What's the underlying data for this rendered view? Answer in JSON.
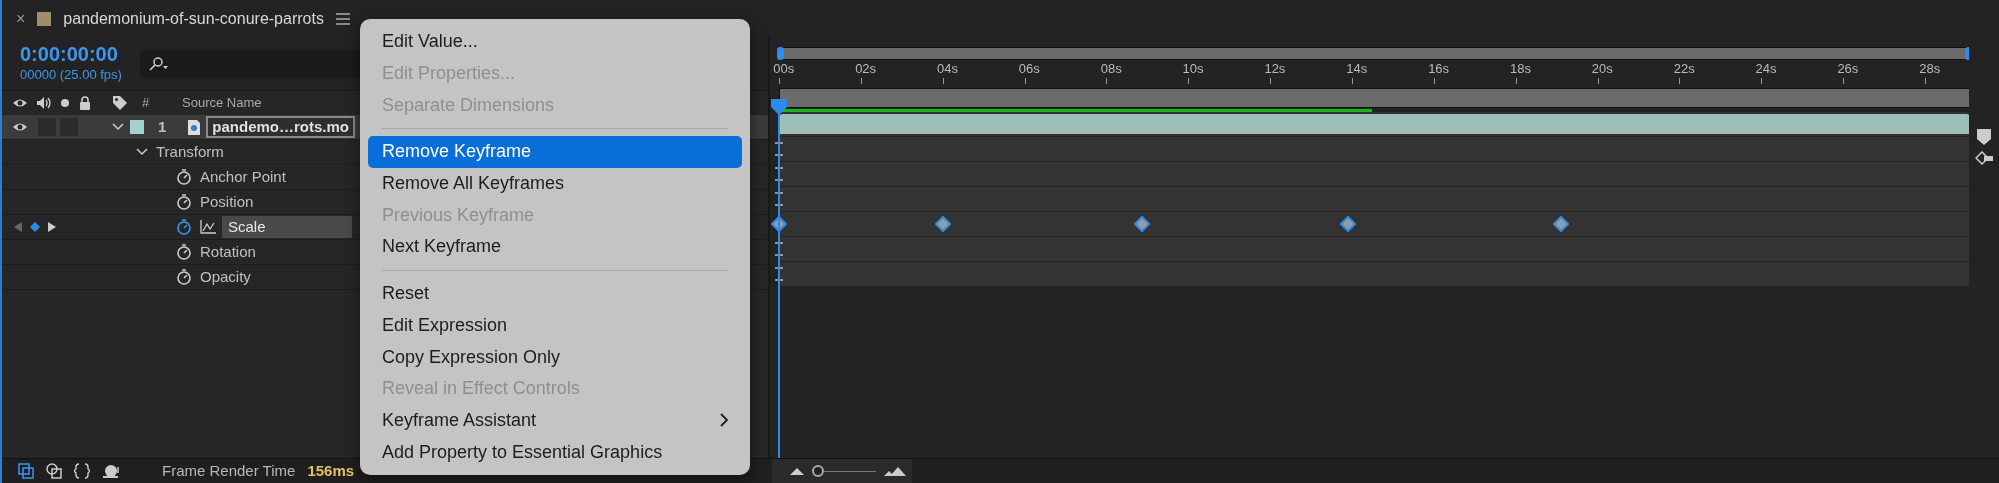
{
  "tab": {
    "close": "×",
    "title": "pandemonium-of-sun-conure-parrots"
  },
  "timecode": "0:00:00:00",
  "frame_info": "00000 (25.00 fps)",
  "columns": [
    "#",
    "Source Name"
  ],
  "layer": {
    "number": "1",
    "name": "pandemo…rots.mo",
    "expanded": true,
    "visible": true
  },
  "group": {
    "name": "Transform",
    "expanded": true
  },
  "properties": [
    {
      "name": "Anchor Point",
      "animated": false,
      "selected": false
    },
    {
      "name": "Position",
      "animated": false,
      "selected": false
    },
    {
      "name": "Scale",
      "animated": true,
      "selected": true
    },
    {
      "name": "Rotation",
      "animated": false,
      "selected": false
    },
    {
      "name": "Opacity",
      "animated": false,
      "selected": false
    }
  ],
  "timeline": {
    "ruler": [
      "00s",
      "02s",
      "04s",
      "06s",
      "08s",
      "10s",
      "12s",
      "14s",
      "16s",
      "18s",
      "20s",
      "22s",
      "24s",
      "26s",
      "28s"
    ],
    "playhead": {
      "level": 0
    },
    "render_bar": {
      "level": 0.498
    },
    "keyframes": [
      {
        "level": 0
      },
      {
        "level": 0.138
      },
      {
        "level": 0.305
      },
      {
        "level": 0.478
      },
      {
        "level": 0.657
      }
    ],
    "zoom_slider": {
      "level": 0
    }
  },
  "status": {
    "label": "Frame Render Time",
    "value": "156ms"
  },
  "menu": [
    {
      "kind": "item",
      "label": "Edit Value...",
      "disabled": false,
      "selected": false,
      "submenu": false
    },
    {
      "kind": "item",
      "label": "Edit Properties...",
      "disabled": true,
      "selected": false,
      "submenu": false
    },
    {
      "kind": "item",
      "label": "Separate Dimensions",
      "disabled": true,
      "selected": false,
      "submenu": false
    },
    {
      "kind": "separator"
    },
    {
      "kind": "item",
      "label": "Remove Keyframe",
      "disabled": false,
      "selected": true,
      "submenu": false
    },
    {
      "kind": "item",
      "label": "Remove All Keyframes",
      "disabled": false,
      "selected": false,
      "submenu": false
    },
    {
      "kind": "item",
      "label": "Previous Keyframe",
      "disabled": true,
      "selected": false,
      "submenu": false
    },
    {
      "kind": "item",
      "label": "Next Keyframe",
      "disabled": false,
      "selected": false,
      "submenu": false
    },
    {
      "kind": "separator"
    },
    {
      "kind": "item",
      "label": "Reset",
      "disabled": false,
      "selected": false,
      "submenu": false
    },
    {
      "kind": "item",
      "label": "Edit Expression",
      "disabled": false,
      "selected": false,
      "submenu": false
    },
    {
      "kind": "item",
      "label": "Copy Expression Only",
      "disabled": false,
      "selected": false,
      "submenu": false
    },
    {
      "kind": "item",
      "label": "Reveal in Effect Controls",
      "disabled": true,
      "selected": false,
      "submenu": false
    },
    {
      "kind": "item",
      "label": "Keyframe Assistant",
      "disabled": false,
      "selected": false,
      "submenu": true
    },
    {
      "kind": "item",
      "label": "Add Property to Essential Graphics",
      "disabled": false,
      "selected": false,
      "submenu": false
    }
  ]
}
